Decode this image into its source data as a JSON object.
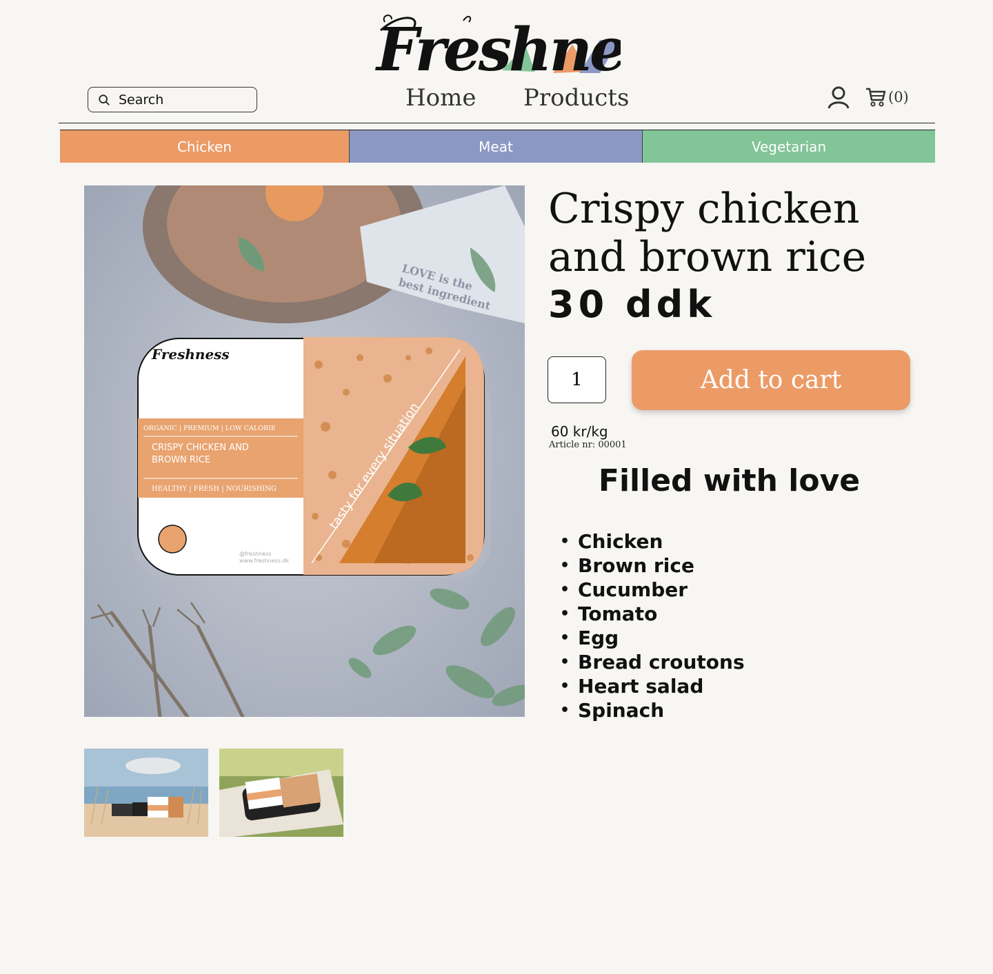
{
  "brand": {
    "logo_text": "Freshness",
    "colors": {
      "orange": "#ec9b66",
      "blue": "#8c98c4",
      "green": "#82c597"
    }
  },
  "search": {
    "placeholder": "Search",
    "icon": "search-icon"
  },
  "nav": {
    "home": "Home",
    "products": "Products"
  },
  "header_icons": {
    "user_icon": "user-icon",
    "cart_icon": "cart-icon",
    "cart_count": "(0)"
  },
  "categories": [
    {
      "label": "Chicken",
      "color": "#ec9b66"
    },
    {
      "label": "Meat",
      "color": "#8c98c4"
    },
    {
      "label": "Vegetarian",
      "color": "#82c597"
    }
  ],
  "product": {
    "title": "Crispy chicken and brown rice",
    "price": "30 ddk",
    "quantity": "1",
    "add_to_cart": "Add to cart",
    "price_per_kg": "60 kr/kg",
    "article": "Article nr: 00001",
    "package": {
      "brand": "Freshness",
      "tags_top": "ORGANIC | PREMIUM | LOW CALORIE",
      "name": "CRISPY CHICKEN AND BROWN RICE",
      "tags_bottom": "HEALTHY | FRESH | NOURISHING",
      "slogan": "tasty for every situation",
      "handle": "@freshness",
      "website": "www.freshness.dk"
    },
    "napkin_text": "LOVE is the best ingredient"
  },
  "description": {
    "heading": "Filled with love",
    "ingredients": [
      "Chicken",
      "Brown rice",
      "Cucumber",
      "Tomato",
      "Egg",
      "Bread croutons",
      "Heart salad",
      "Spinach"
    ]
  }
}
